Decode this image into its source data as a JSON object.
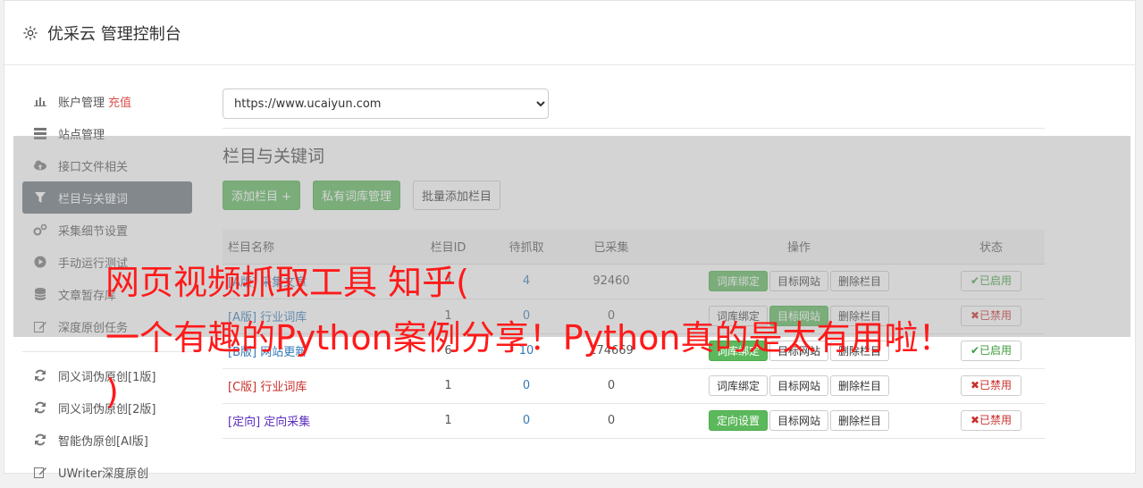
{
  "header": {
    "title": "优采云 管理控制台",
    "icon": "gear-icon"
  },
  "sidebar": {
    "items": [
      {
        "label": "账户管理",
        "extra": "充值",
        "icon": "bar-chart-icon"
      },
      {
        "label": "站点管理",
        "icon": "server-icon"
      },
      {
        "label": "接口文件相关",
        "icon": "cloud-upload-icon"
      },
      {
        "label": "栏目与关键词",
        "icon": "filter-icon",
        "active": true
      },
      {
        "label": "采集细节设置",
        "icon": "gears-icon"
      },
      {
        "label": "手动运行测试",
        "icon": "play-icon"
      },
      {
        "label": "文章暂存库",
        "icon": "database-icon"
      },
      {
        "label": "深度原创任务",
        "icon": "edit-icon"
      }
    ],
    "items2": [
      {
        "label": "同义词伪原创[1版]",
        "icon": "refresh-icon"
      },
      {
        "label": "同义词伪原创[2版]",
        "icon": "refresh-icon"
      },
      {
        "label": "智能伪原创[AI版]",
        "icon": "refresh-icon"
      },
      {
        "label": "UWriter深度原创",
        "icon": "edit-icon"
      }
    ]
  },
  "main": {
    "site_select": "https://www.ucaiyun.com",
    "section_title": "栏目与关键词",
    "buttons": {
      "add": "添加栏目 +",
      "lexicon": "私有词库管理",
      "batch": "批量添加栏目"
    },
    "table": {
      "headers": [
        "栏目名称",
        "栏目ID",
        "待抓取",
        "已采集",
        "操作",
        "状态"
      ],
      "rows": [
        {
          "tag": "[A版]",
          "name": "采集文章",
          "id": "4",
          "wait": "4",
          "got": "92460",
          "bind": "词库绑定",
          "target": "目标网站",
          "del": "删除栏目",
          "status": "已启用"
        },
        {
          "tag": "[A版]",
          "name": "行业词库",
          "id": "1",
          "wait": "0",
          "got": "0",
          "bind": "词库绑定",
          "target": "目标网站",
          "del": "删除栏目",
          "status": "已禁用"
        },
        {
          "tag": "[B版]",
          "name": "网站更新",
          "id": "6",
          "wait": "10",
          "got": "174669",
          "bind": "词库绑定",
          "target": "目标网站",
          "del": "删除栏目",
          "status": "已启用"
        },
        {
          "tag": "[C版]",
          "name": "行业词库",
          "id": "1",
          "wait": "0",
          "got": "0",
          "bind": "词库绑定",
          "target": "目标网站",
          "del": "删除栏目",
          "status": "已禁用"
        },
        {
          "tag": "[定向]",
          "name": "定向采集",
          "id": "1",
          "wait": "0",
          "got": "0",
          "bind": "定向设置",
          "target": "目标网站",
          "del": "删除栏目",
          "status": "已禁用"
        }
      ]
    }
  },
  "watermark": {
    "line1": "网页视频抓取工具 知乎(",
    "line2": "一个有趣的Python案例分享！Python真的是太有用啦！",
    "line3": ")"
  }
}
